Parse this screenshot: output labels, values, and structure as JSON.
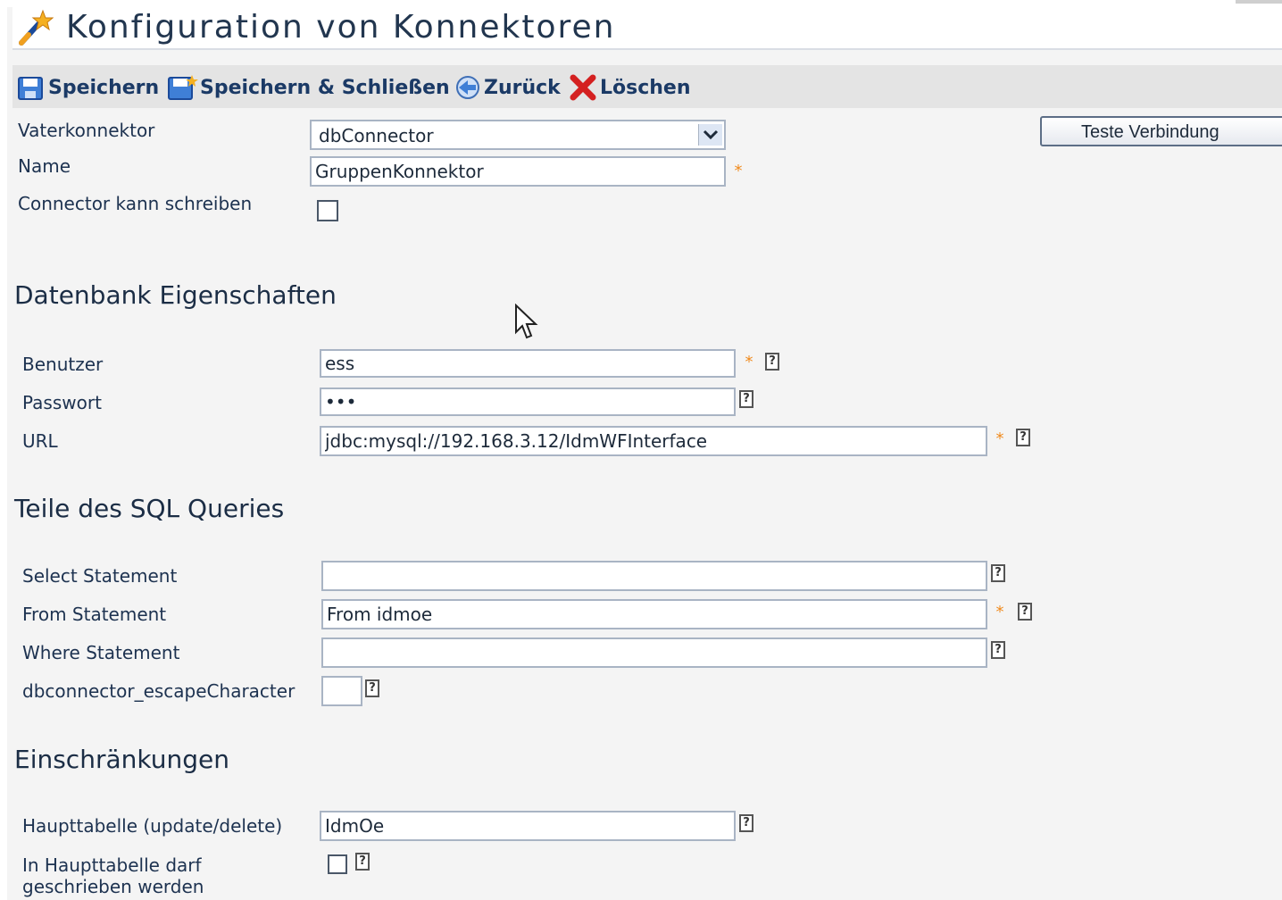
{
  "page": {
    "title": "Konfiguration von Konnektoren"
  },
  "toolbar": {
    "save": "Speichern",
    "save_close": "Speichern & Schließen",
    "back": "Zurück",
    "delete": "Löschen"
  },
  "general": {
    "parent_label": "Vaterkonnektor",
    "parent_value": "dbConnector",
    "name_label": "Name",
    "name_value": "GruppenKonnektor",
    "can_write_label": "Connector kann schreiben",
    "can_write_checked": false,
    "test_button": "Teste Verbindung"
  },
  "database": {
    "heading": "Datenbank Eigenschaften",
    "user_label": "Benutzer",
    "user_value": "ess",
    "password_label": "Passwort",
    "password_value": "•••",
    "url_label": "URL",
    "url_value": "jdbc:mysql://192.168.3.12/IdmWFInterface"
  },
  "sql": {
    "heading": "Teile des SQL Queries",
    "select_label": "Select Statement",
    "select_value": "",
    "from_label": "From Statement",
    "from_value": "From idmoe",
    "where_label": "Where Statement",
    "where_value": "",
    "escape_label": "dbconnector_escapeCharacter",
    "escape_value": ""
  },
  "restrictions": {
    "heading": "Einschränkungen",
    "main_table_label": "Haupttabelle (update/delete)",
    "main_table_value": "IdmOe",
    "may_write_label_line1": "In Haupttabelle darf",
    "may_write_label_line2": "geschrieben werden",
    "may_write_checked": false
  },
  "markers": {
    "required": "*",
    "help": "?"
  },
  "colors": {
    "accent": "#1b3a66",
    "required": "#f08a1c",
    "toolbar_bg": "#e4e4e4"
  }
}
